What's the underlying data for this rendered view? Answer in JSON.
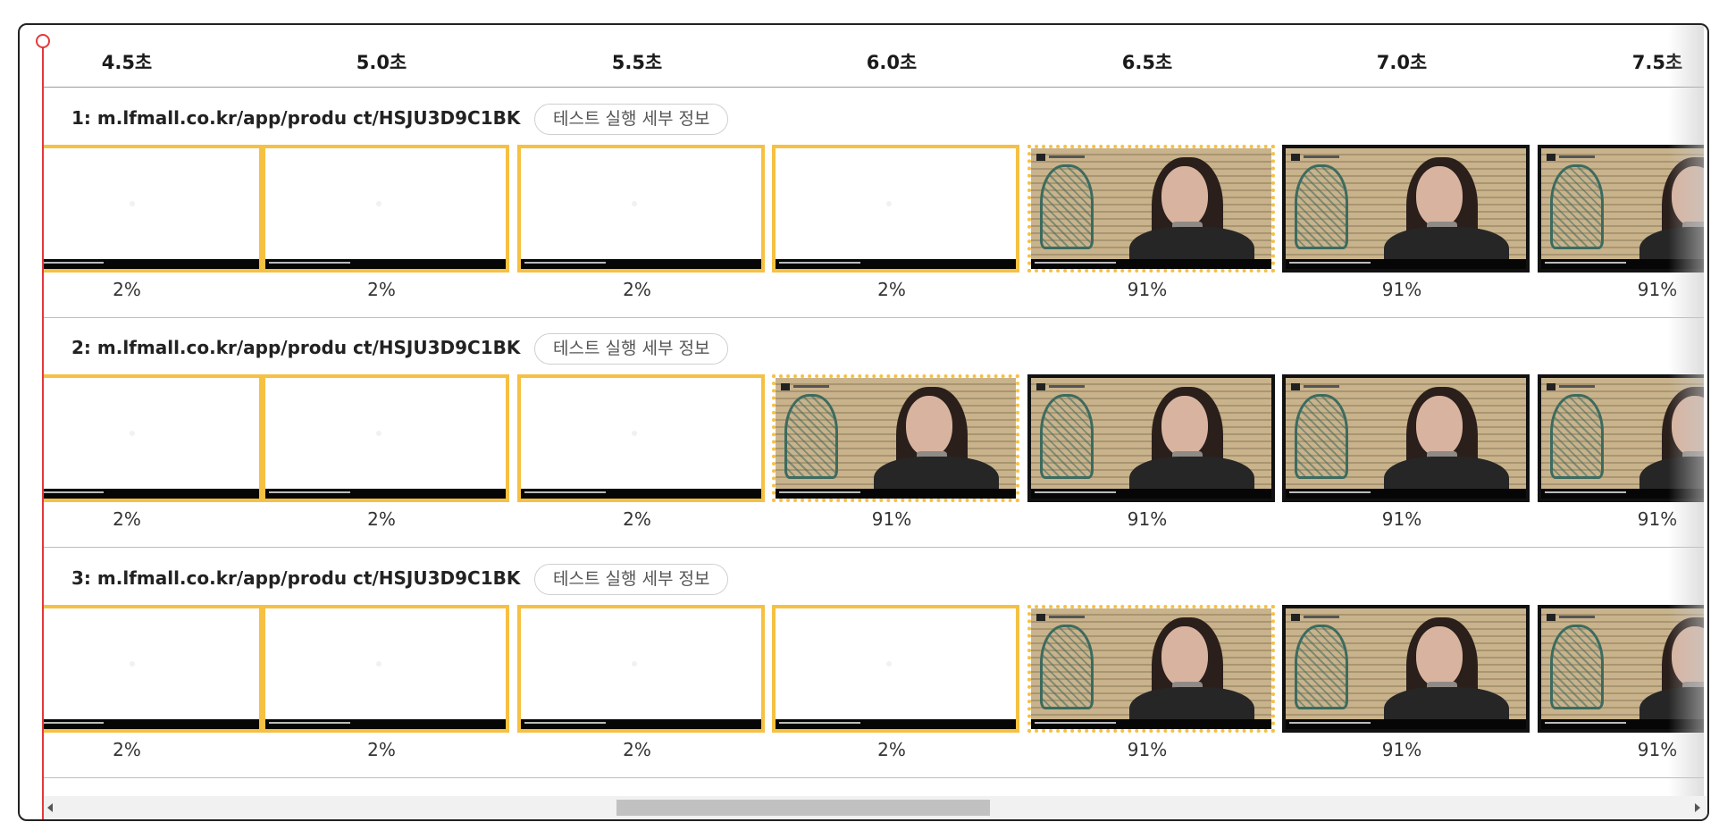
{
  "time_axis": [
    "4.5초",
    "5.0초",
    "5.5초",
    "6.0초",
    "6.5초",
    "7.0초",
    "7.5초"
  ],
  "details_label": "테스트 실행 세부 정보",
  "colors": {
    "changed_border": "#f6c042",
    "complete_border": "#111111",
    "playhead": "#e4383b"
  },
  "rows": [
    {
      "title": "1: m.lfmall.co.kr/app/produ ct/HSJU3D9C1BK",
      "frames": [
        {
          "state": "changed",
          "percent": "2%"
        },
        {
          "state": "changed",
          "percent": "2%"
        },
        {
          "state": "changed",
          "percent": "2%"
        },
        {
          "state": "changed",
          "percent": "2%"
        },
        {
          "state": "loaded-change",
          "percent": "91%"
        },
        {
          "state": "complete",
          "percent": "91%"
        },
        {
          "state": "complete",
          "percent": "91%"
        }
      ]
    },
    {
      "title": "2: m.lfmall.co.kr/app/produ ct/HSJU3D9C1BK",
      "frames": [
        {
          "state": "changed",
          "percent": "2%"
        },
        {
          "state": "changed",
          "percent": "2%"
        },
        {
          "state": "changed",
          "percent": "2%"
        },
        {
          "state": "loaded-change",
          "percent": "91%"
        },
        {
          "state": "complete",
          "percent": "91%"
        },
        {
          "state": "complete",
          "percent": "91%"
        },
        {
          "state": "complete",
          "percent": "91%"
        }
      ]
    },
    {
      "title": "3: m.lfmall.co.kr/app/produ ct/HSJU3D9C1BK",
      "frames": [
        {
          "state": "changed",
          "percent": "2%"
        },
        {
          "state": "changed",
          "percent": "2%"
        },
        {
          "state": "changed",
          "percent": "2%"
        },
        {
          "state": "changed",
          "percent": "2%"
        },
        {
          "state": "loaded-change",
          "percent": "91%"
        },
        {
          "state": "complete",
          "percent": "91%"
        },
        {
          "state": "complete",
          "percent": "91%"
        }
      ]
    }
  ]
}
